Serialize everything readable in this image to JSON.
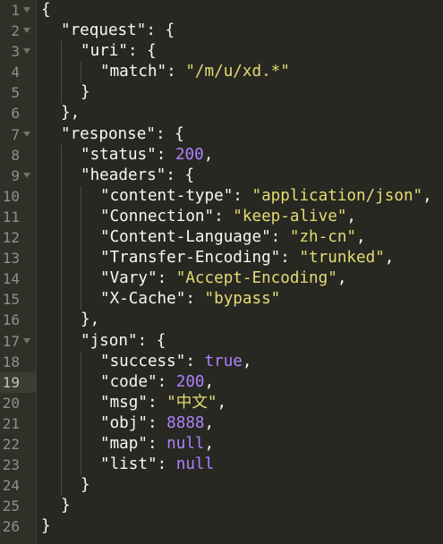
{
  "editor": {
    "language": "json",
    "colors": {
      "background": "#272822",
      "gutter": "#2f3129",
      "text": "#f8f8f2",
      "string": "#e6db74",
      "number": "#ae81ff",
      "line_number": "#8f908a"
    },
    "active_line": 19,
    "fold_markers": [
      1,
      2,
      3,
      7,
      9,
      17
    ],
    "lines": [
      {
        "n": "1",
        "indent": 0,
        "tokens": [
          {
            "t": "p",
            "v": "{"
          }
        ]
      },
      {
        "n": "2",
        "indent": 1,
        "tokens": [
          {
            "t": "k",
            "v": "\"request\""
          },
          {
            "t": "p",
            "v": ": {"
          }
        ]
      },
      {
        "n": "3",
        "indent": 2,
        "tokens": [
          {
            "t": "k",
            "v": "\"uri\""
          },
          {
            "t": "p",
            "v": ": {"
          }
        ]
      },
      {
        "n": "4",
        "indent": 3,
        "tokens": [
          {
            "t": "k",
            "v": "\"match\""
          },
          {
            "t": "p",
            "v": ": "
          },
          {
            "t": "s",
            "v": "\"/m/u/xd.*\""
          }
        ]
      },
      {
        "n": "5",
        "indent": 2,
        "tokens": [
          {
            "t": "p",
            "v": "}"
          }
        ]
      },
      {
        "n": "6",
        "indent": 1,
        "tokens": [
          {
            "t": "p",
            "v": "},"
          }
        ]
      },
      {
        "n": "7",
        "indent": 1,
        "tokens": [
          {
            "t": "k",
            "v": "\"response\""
          },
          {
            "t": "p",
            "v": ": {"
          }
        ]
      },
      {
        "n": "8",
        "indent": 2,
        "tokens": [
          {
            "t": "k",
            "v": "\"status\""
          },
          {
            "t": "p",
            "v": ": "
          },
          {
            "t": "n",
            "v": "200"
          },
          {
            "t": "p",
            "v": ","
          }
        ]
      },
      {
        "n": "9",
        "indent": 2,
        "tokens": [
          {
            "t": "k",
            "v": "\"headers\""
          },
          {
            "t": "p",
            "v": ": {"
          }
        ]
      },
      {
        "n": "10",
        "indent": 3,
        "tokens": [
          {
            "t": "k",
            "v": "\"content-type\""
          },
          {
            "t": "p",
            "v": ": "
          },
          {
            "t": "s",
            "v": "\"application/json\""
          },
          {
            "t": "p",
            "v": ","
          }
        ]
      },
      {
        "n": "11",
        "indent": 3,
        "tokens": [
          {
            "t": "k",
            "v": "\"Connection\""
          },
          {
            "t": "p",
            "v": ": "
          },
          {
            "t": "s",
            "v": "\"keep-alive\""
          },
          {
            "t": "p",
            "v": ","
          }
        ]
      },
      {
        "n": "12",
        "indent": 3,
        "tokens": [
          {
            "t": "k",
            "v": "\"Content-Language\""
          },
          {
            "t": "p",
            "v": ": "
          },
          {
            "t": "s",
            "v": "\"zh-cn\""
          },
          {
            "t": "p",
            "v": ","
          }
        ]
      },
      {
        "n": "13",
        "indent": 3,
        "tokens": [
          {
            "t": "k",
            "v": "\"Transfer-Encoding\""
          },
          {
            "t": "p",
            "v": ": "
          },
          {
            "t": "s",
            "v": "\"trunked\""
          },
          {
            "t": "p",
            "v": ","
          }
        ]
      },
      {
        "n": "14",
        "indent": 3,
        "tokens": [
          {
            "t": "k",
            "v": "\"Vary\""
          },
          {
            "t": "p",
            "v": ": "
          },
          {
            "t": "s",
            "v": "\"Accept-Encoding\""
          },
          {
            "t": "p",
            "v": ","
          }
        ]
      },
      {
        "n": "15",
        "indent": 3,
        "tokens": [
          {
            "t": "k",
            "v": "\"X-Cache\""
          },
          {
            "t": "p",
            "v": ": "
          },
          {
            "t": "s",
            "v": "\"bypass\""
          }
        ]
      },
      {
        "n": "16",
        "indent": 2,
        "tokens": [
          {
            "t": "p",
            "v": "},"
          }
        ]
      },
      {
        "n": "17",
        "indent": 2,
        "tokens": [
          {
            "t": "k",
            "v": "\"json\""
          },
          {
            "t": "p",
            "v": ": {"
          }
        ]
      },
      {
        "n": "18",
        "indent": 3,
        "tokens": [
          {
            "t": "k",
            "v": "\"success\""
          },
          {
            "t": "p",
            "v": ": "
          },
          {
            "t": "n",
            "v": "true"
          },
          {
            "t": "p",
            "v": ","
          }
        ]
      },
      {
        "n": "19",
        "indent": 3,
        "tokens": [
          {
            "t": "k",
            "v": "\"code\""
          },
          {
            "t": "p",
            "v": ": "
          },
          {
            "t": "n",
            "v": "200"
          },
          {
            "t": "p",
            "v": ","
          }
        ]
      },
      {
        "n": "20",
        "indent": 3,
        "tokens": [
          {
            "t": "k",
            "v": "\"msg\""
          },
          {
            "t": "p",
            "v": ": "
          },
          {
            "t": "s",
            "v": "\"中文\""
          },
          {
            "t": "p",
            "v": ","
          }
        ]
      },
      {
        "n": "21",
        "indent": 3,
        "tokens": [
          {
            "t": "k",
            "v": "\"obj\""
          },
          {
            "t": "p",
            "v": ": "
          },
          {
            "t": "n",
            "v": "8888"
          },
          {
            "t": "p",
            "v": ","
          }
        ]
      },
      {
        "n": "22",
        "indent": 3,
        "tokens": [
          {
            "t": "k",
            "v": "\"map\""
          },
          {
            "t": "p",
            "v": ": "
          },
          {
            "t": "n",
            "v": "null"
          },
          {
            "t": "p",
            "v": ","
          }
        ]
      },
      {
        "n": "23",
        "indent": 3,
        "tokens": [
          {
            "t": "k",
            "v": "\"list\""
          },
          {
            "t": "p",
            "v": ": "
          },
          {
            "t": "n",
            "v": "null"
          }
        ]
      },
      {
        "n": "24",
        "indent": 2,
        "tokens": [
          {
            "t": "p",
            "v": "}"
          }
        ]
      },
      {
        "n": "25",
        "indent": 1,
        "tokens": [
          {
            "t": "p",
            "v": "}"
          }
        ]
      },
      {
        "n": "26",
        "indent": 0,
        "tokens": [
          {
            "t": "p",
            "v": "}"
          }
        ]
      }
    ]
  }
}
